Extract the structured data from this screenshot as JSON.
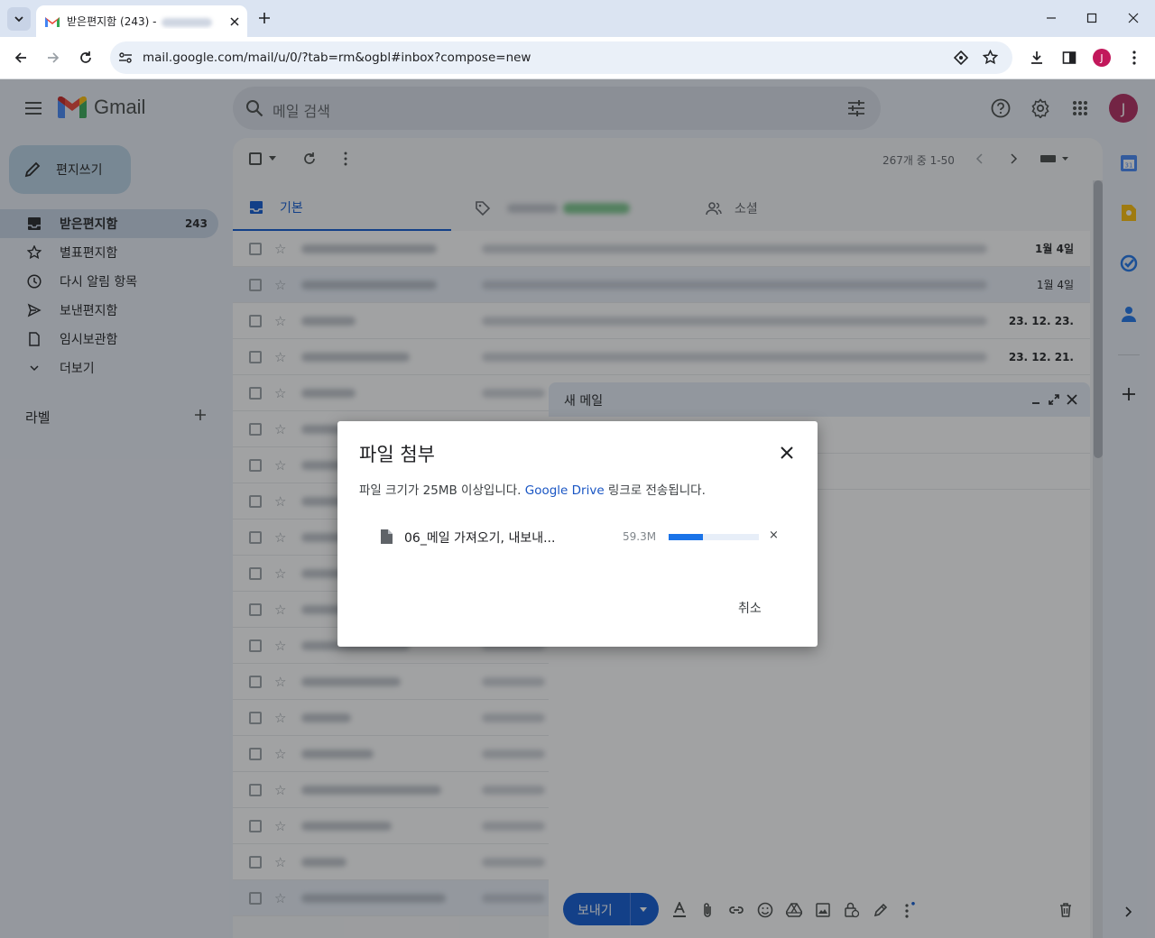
{
  "browser": {
    "tab_title": "받은편지함 (243) -",
    "url": "mail.google.com/mail/u/0/?tab=rm&ogbl#inbox?compose=new",
    "profile_initial": "J"
  },
  "gmail": {
    "logo_text": "Gmail",
    "search_placeholder": "메일 검색",
    "avatar_initial": "J",
    "compose_label": "편지쓰기",
    "nav": [
      {
        "label": "받은편지함",
        "count": "243",
        "icon": "inbox-icon"
      },
      {
        "label": "별표편지함",
        "count": "",
        "icon": "star-icon"
      },
      {
        "label": "다시 알림 항목",
        "count": "",
        "icon": "clock-icon"
      },
      {
        "label": "보낸편지함",
        "count": "",
        "icon": "send-icon"
      },
      {
        "label": "임시보관함",
        "count": "",
        "icon": "draft-icon"
      },
      {
        "label": "더보기",
        "count": "",
        "icon": "chevron-down-icon"
      }
    ],
    "labels_header": "라벨",
    "pager_text": "267개 중 1-50",
    "tabs": {
      "primary": "기본",
      "social": "소셜"
    },
    "dates": [
      "1월 4일",
      "1월 4일",
      "23. 12. 23.",
      "23. 12. 21."
    ]
  },
  "compose_window": {
    "title": "새 메일",
    "send_label": "보내기"
  },
  "dialog": {
    "title": "파일 첨부",
    "message_before": "파일 크기가 25MB 이상입니다. ",
    "message_link": "Google Drive",
    "message_after": " 링크로 전송됩니다.",
    "file_name": "06_메일 가져오기, 내보내...",
    "file_size": "59.3M",
    "upload_progress_percent": 38,
    "remove_glyph": "×",
    "cancel_label": "취소"
  },
  "colors": {
    "accent": "#0b57d0",
    "progress": "#1a73e8",
    "avatar": "#b0275c"
  }
}
